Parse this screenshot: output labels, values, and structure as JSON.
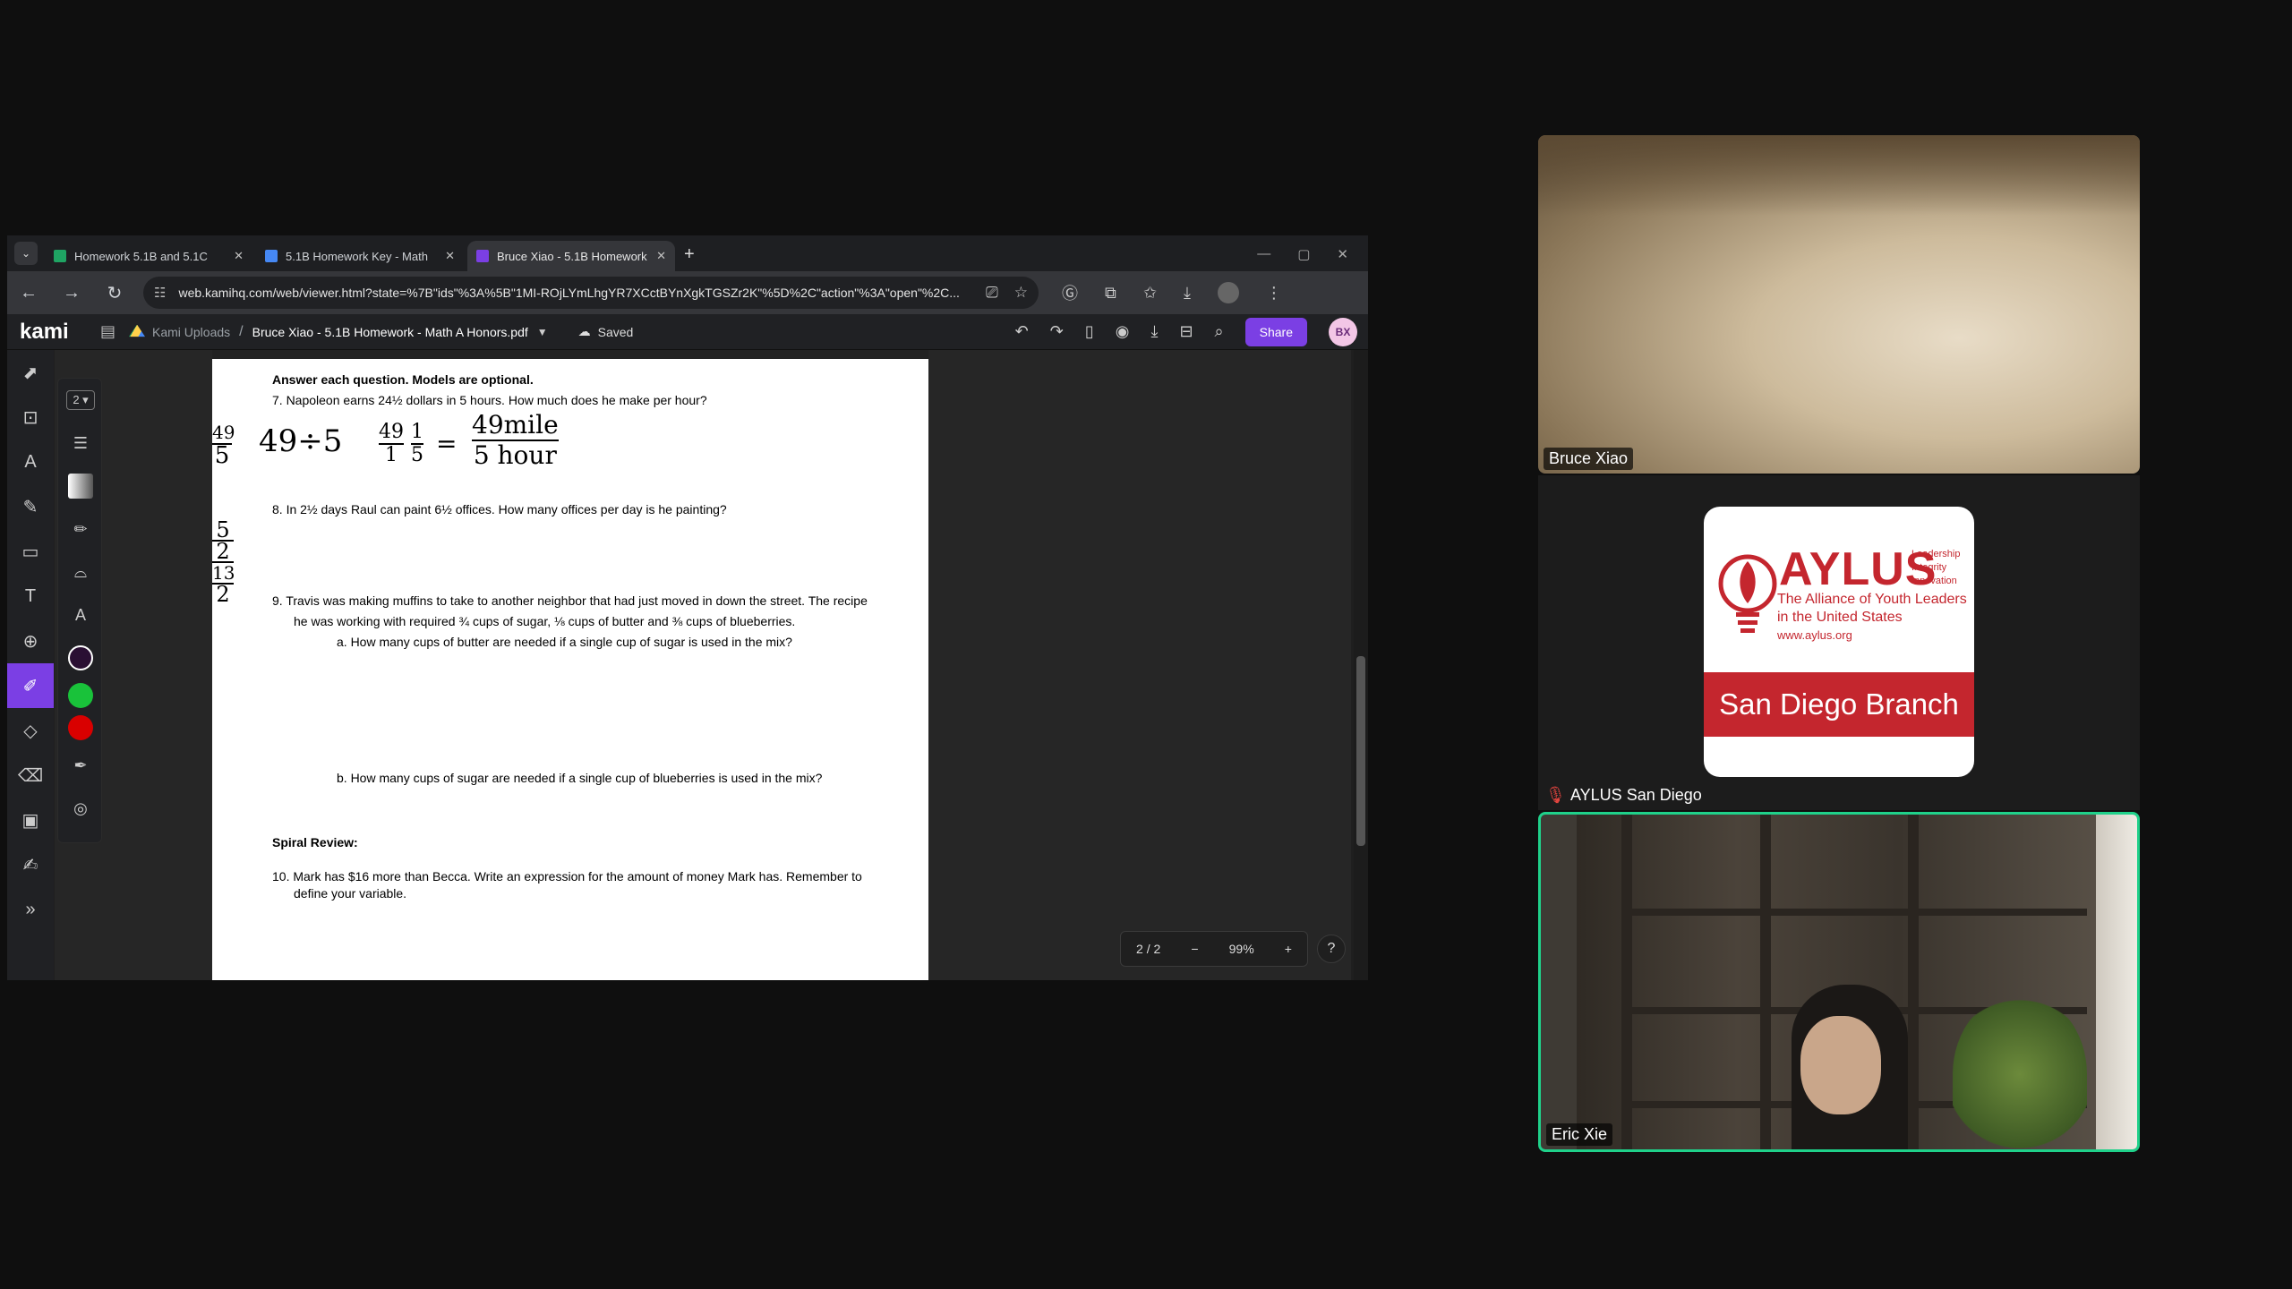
{
  "browser": {
    "tabs": [
      {
        "title": "Homework 5.1B and 5.1C",
        "color": "#1fa463"
      },
      {
        "title": "5.1B Homework Key - Math",
        "color": "#4688f4"
      },
      {
        "title": "Bruce Xiao - 5.1B Homework",
        "color": "#7b3fe4"
      }
    ],
    "url": "web.kamihq.com/web/viewer.html?state=%7B\"ids\"%3A%5B\"1MI-ROjLYmLhgYR7XCctBYnXgkTGSZr2K\"%5D%2C\"action\"%3A\"open\"%2C..."
  },
  "kami": {
    "logo": "kami",
    "breadcrumb_root": "Kami Uploads",
    "file_name": "Bruce Xiao - 5.1B Homework - Math A Honors.pdf",
    "status": "Saved",
    "share_label": "Share",
    "user_initials": "BX",
    "stroke_size": "2",
    "colors": [
      "#2a0f33",
      "#19c23a",
      "#d90000"
    ]
  },
  "document": {
    "instructions": "Answer each question. Models are optional.",
    "q7": "7.   Napoleon earns 24½ dollars in 5 hours.  How much does he make per hour?",
    "q8": "8.   In 2½ days Raul can paint 6½ offices.  How many offices per day is he painting?",
    "q9_line1": "9.   Travis was making muffins to take to another neighbor that had just moved in down the street.  The recipe",
    "q9_line2": "he was working with required ¾ cups of sugar, ⅛ cups of butter and ⅜ cups of blueberries.",
    "q9a": "a.   How many cups of butter are needed if a single cup of sugar is used in the mix?",
    "q9b": "b.   How many cups of sugar are needed if a single cup of blueberries is used in the mix?",
    "spiral": "Spiral Review:",
    "q10_line1": "10. Mark has $16 more than Becca.  Write an expression for the amount of money Mark has.  Remember to",
    "q10_line2": "define your variable.",
    "handwriting": {
      "a": "49",
      "b": "5",
      "c": "49÷5",
      "d": "49",
      "e": "1",
      "f": "1",
      "g": "5",
      "h": "49mile",
      "i": "5 hour",
      "j": "5",
      "k": "2",
      "l": "13",
      "m": "2"
    }
  },
  "viewer": {
    "page": "2 / 2",
    "zoom": "99%"
  },
  "participants": [
    {
      "name": "Bruce Xiao"
    },
    {
      "name": "AYLUS San Diego"
    },
    {
      "name": "Eric Xie"
    }
  ],
  "aylus_logo": {
    "title": "AYLUS",
    "values": [
      "Leadership",
      "Integrity",
      "Innovation"
    ],
    "tagline1": "The Alliance of Youth Leaders",
    "tagline2": "in the United States",
    "site": "www.aylus.org",
    "branch": "San Diego Branch"
  }
}
